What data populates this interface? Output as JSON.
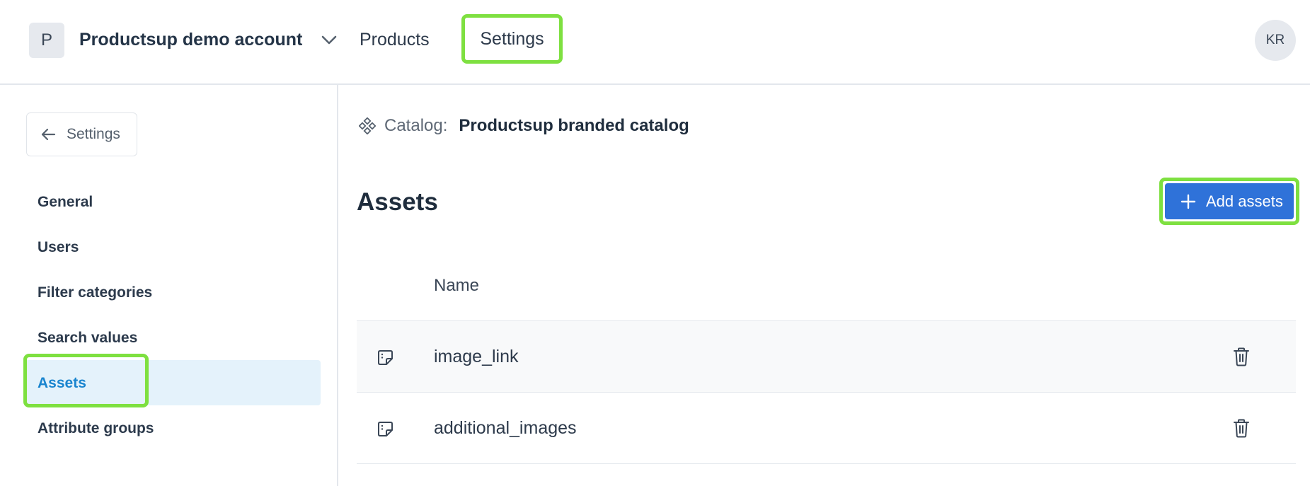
{
  "header": {
    "account_initial": "P",
    "account_name": "Productsup demo account",
    "nav": [
      {
        "label": "Products"
      },
      {
        "label": "Settings"
      }
    ],
    "user_initials": "KR"
  },
  "sidebar": {
    "back_label": "Settings",
    "items": [
      {
        "label": "General"
      },
      {
        "label": "Users"
      },
      {
        "label": "Filter categories"
      },
      {
        "label": "Search values"
      },
      {
        "label": "Assets"
      },
      {
        "label": "Attribute groups"
      }
    ],
    "active_item": "Assets"
  },
  "main": {
    "catalog_label": "Catalog:",
    "catalog_value": "Productsup branded catalog",
    "title": "Assets",
    "add_button_label": "Add assets",
    "table": {
      "column_name": "Name",
      "rows": [
        {
          "name": "image_link"
        },
        {
          "name": "additional_images"
        }
      ]
    }
  },
  "colors": {
    "accent": "#2f72d9",
    "highlight_outline": "#7ee040",
    "active_nav_bg": "#e4f2fb",
    "active_nav_text": "#1a85cf"
  },
  "icons": {
    "back": "arrow-left-icon",
    "account_switch": "chevron-down-icon",
    "catalog": "catalog-icon",
    "add": "plus-icon",
    "row": "asset-note-icon",
    "delete": "trash-icon"
  }
}
